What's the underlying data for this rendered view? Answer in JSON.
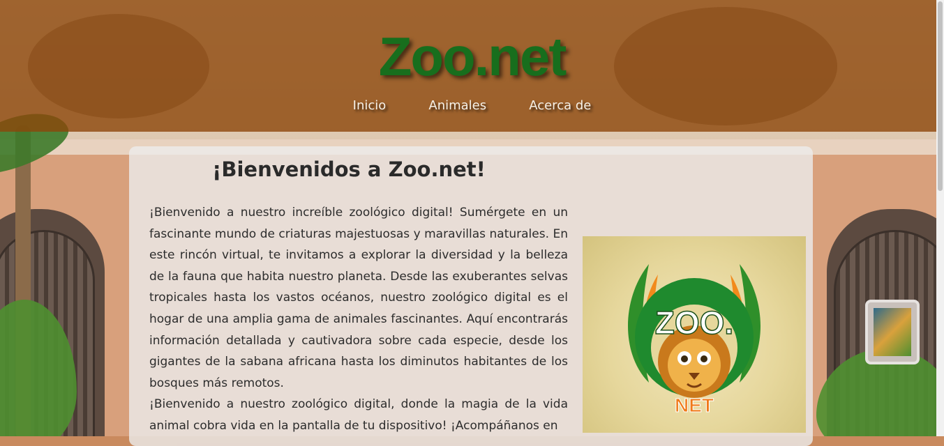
{
  "header": {
    "logo_text": "Zoo.net",
    "nav": [
      "Inicio",
      "Animales",
      "Acerca de"
    ]
  },
  "main": {
    "title": "¡Bienvenidos a Zoo.net!",
    "paragraphs": [
      "¡Bienvenido a nuestro increíble zoológico digital! Sumérgete en un fascinante mundo de criaturas majestuosas y maravillas naturales. En este rincón virtual, te invitamos a explorar la diversidad y la belleza de la fauna que habita nuestro planeta. Desde las exuberantes selvas tropicales hasta los vastos océanos, nuestro zoológico digital es el hogar de una amplia gama de animales fascinantes. Aquí encontrarás información detallada y cautivadora sobre cada especie, desde los gigantes de la sabana africana hasta los diminutos habitantes de los bosques más remotos.",
      "¡Bienvenido a nuestro zoológico digital, donde la magia de la vida animal cobra vida en la pantalla de tu dispositivo! ¡Acompáñanos en"
    ],
    "logo_image": {
      "top_text": "ZOO.",
      "bottom_text": "NET"
    }
  },
  "colors": {
    "header": "#8c460a",
    "logo_green": "#186e1d",
    "net_orange": "#f07a1a"
  }
}
